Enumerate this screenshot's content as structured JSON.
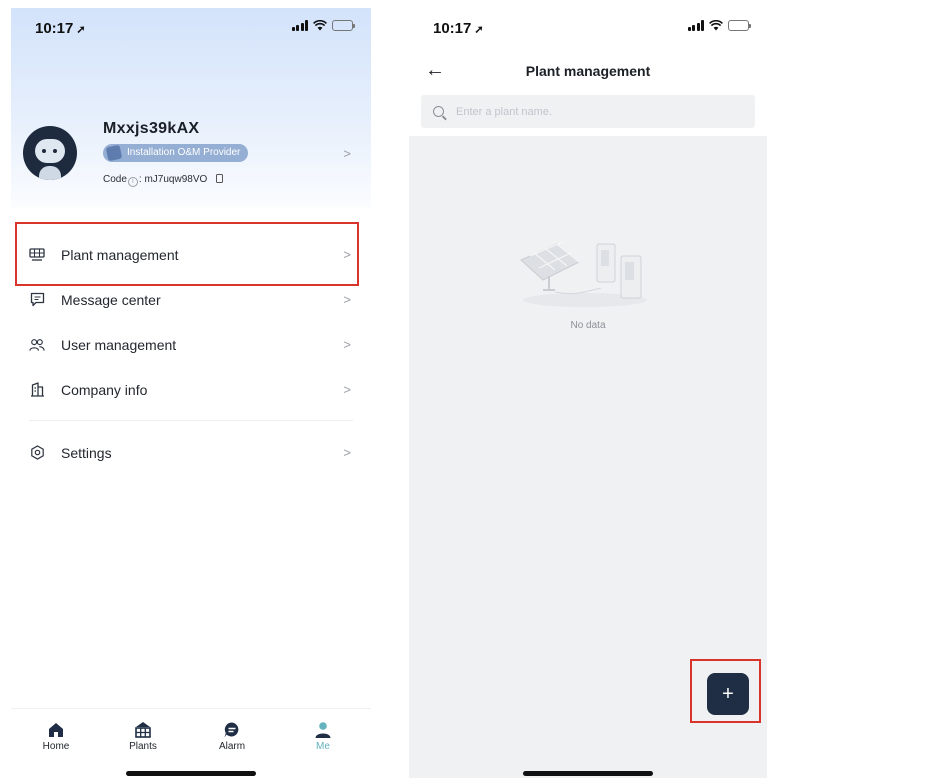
{
  "left_screen": {
    "status_bar": {
      "time": "10:17"
    },
    "profile": {
      "username": "Mxxjs39kAX",
      "role": "Installation O&M Provider",
      "code_label": "Code",
      "code_separator": ":",
      "code_value": "mJ7uqw98VO"
    },
    "menu": [
      {
        "label": "Plant management",
        "icon": "plant-icon"
      },
      {
        "label": "Message center",
        "icon": "message-icon"
      },
      {
        "label": "User management",
        "icon": "users-icon"
      },
      {
        "label": "Company info",
        "icon": "building-icon"
      },
      {
        "label": "Settings",
        "icon": "settings-icon"
      }
    ],
    "chevron": ">",
    "tabs": [
      {
        "label": "Home",
        "icon": "home-icon"
      },
      {
        "label": "Plants",
        "icon": "plants-icon"
      },
      {
        "label": "Alarm",
        "icon": "alarm-icon"
      },
      {
        "label": "Me",
        "icon": "person-icon",
        "active": true
      }
    ]
  },
  "right_screen": {
    "status_bar": {
      "time": "10:17"
    },
    "back_glyph": "←",
    "title": "Plant management",
    "search": {
      "placeholder": "Enter a plant name.",
      "value": ""
    },
    "empty_text": "No data",
    "fab_label": "+"
  },
  "colors": {
    "highlight": "#d9342b",
    "accent_active_tab": "#63b2bd",
    "fab_background": "#1f2e45",
    "role_badge": "#95aed3"
  }
}
